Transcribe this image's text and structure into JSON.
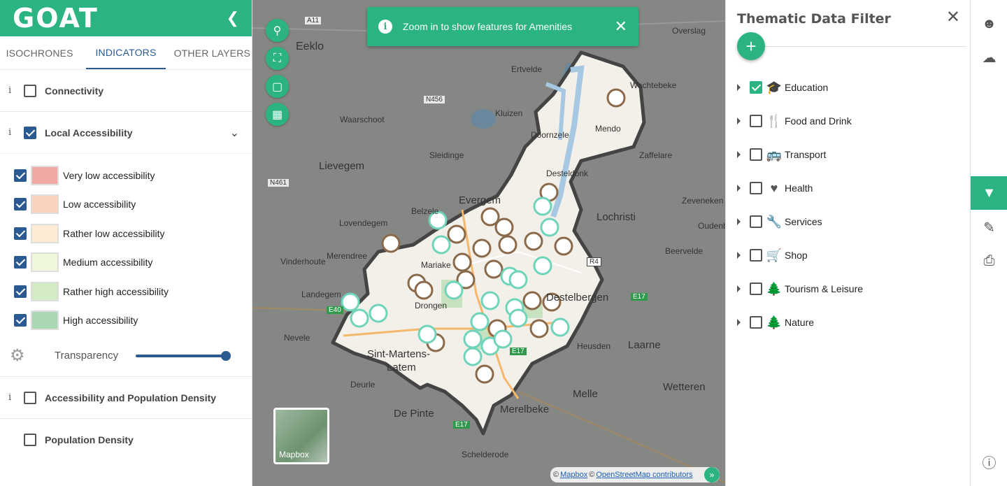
{
  "app": {
    "logo": "GOAT",
    "collapse_icon": "chevron-left-icon"
  },
  "tabs": [
    {
      "label": "ISOCHRONES",
      "active": false
    },
    {
      "label": "INDICATORS",
      "active": true
    },
    {
      "label": "OTHER LAYERS",
      "active": false
    }
  ],
  "layers": {
    "connectivity": {
      "label": "Connectivity",
      "checked": false
    },
    "local_accessibility": {
      "label": "Local Accessibility",
      "checked": true
    },
    "access_pop": {
      "label": "Accessibility and Population Density",
      "checked": false
    },
    "pop_density": {
      "label": "Population Density",
      "checked": false
    }
  },
  "legend": [
    {
      "label": "Very low accessibility",
      "color": "#f2a8a2",
      "checked": true
    },
    {
      "label": "Low accessibility",
      "color": "#fbd3bd",
      "checked": true
    },
    {
      "label": "Rather low accessibility",
      "color": "#fdebd5",
      "checked": true
    },
    {
      "label": "Medium accessibility",
      "color": "#eef6dc",
      "checked": true
    },
    {
      "label": "Rather high accessibility",
      "color": "#d3ecc6",
      "checked": true
    },
    {
      "label": "High accessibility",
      "color": "#a9d6b3",
      "checked": true
    }
  ],
  "transparency": {
    "label": "Transparency",
    "value": 1.0
  },
  "toast": {
    "text": "Zoom in to show features for Amenities"
  },
  "map_labels": {
    "eeklo": "Eeklo",
    "ertvelde": "Ertvelde",
    "wachtebeke": "Wachtebeke",
    "overslag": "Overslag",
    "waarschoot": "Waarschoot",
    "kluizen": "Kluizen",
    "sleidinge": "Sleidinge",
    "zaffelare": "Zaffelare",
    "lievegem": "Lievegem",
    "desteldonk": "Desteldonk",
    "evergem": "Evergem",
    "lochristi": "Lochristi",
    "zeveneken": "Zeveneken",
    "lovendegem": "Lovendegem",
    "belzele": "Belzele",
    "oudenb": "Oudenb",
    "merendree": "Merendree",
    "mariakerke": "Mariake",
    "beervelde": "Beervelde",
    "vinderhoute": "Vinderhoute",
    "landegem": "Landegem",
    "drongen": "Drongen",
    "destelbergen": "Destelbergen",
    "nevele": "Nevele",
    "laarne": "Laarne",
    "heusden": "Heusden",
    "sint_martens": "Sint-Martens-",
    "latem": "Latem",
    "deurle": "Deurle",
    "wetteren": "Wetteren",
    "melle": "Melle",
    "merelbeke": "Merelbeke",
    "de_pinte": "De Pinte",
    "schelderode": "Schelderode",
    "mendonk": "Mendo",
    "doornzele": "Doornzele",
    "a11": "A11",
    "n456": "N456",
    "n461": "N461",
    "e40": "E40",
    "e17a": "E17",
    "e17b": "E17",
    "e17c": "E17",
    "r4": "R4"
  },
  "map_controls": [
    "search-icon",
    "fullscreen-icon",
    "measure-icon",
    "map-style-icon"
  ],
  "basemap": {
    "label": "Mapbox"
  },
  "attribution": {
    "prefix1": "©",
    "mapbox": "Mapbox",
    "prefix2": "©",
    "osm": "OpenStreetMap contributors",
    "expand": "»"
  },
  "filter": {
    "title": "Thematic Data Filter",
    "items": [
      {
        "label": "Education",
        "checked": true,
        "icon": "graduation-cap-icon",
        "glyph": "🎓"
      },
      {
        "label": "Food and Drink",
        "checked": false,
        "icon": "cutlery-icon",
        "glyph": "🍴"
      },
      {
        "label": "Transport",
        "checked": false,
        "icon": "bus-icon",
        "glyph": "🚌"
      },
      {
        "label": "Health",
        "checked": false,
        "icon": "heart-icon",
        "glyph": "♥"
      },
      {
        "label": "Services",
        "checked": false,
        "icon": "wrench-icon",
        "glyph": "🔧"
      },
      {
        "label": "Shop",
        "checked": false,
        "icon": "cart-icon",
        "glyph": "🛒"
      },
      {
        "label": "Tourism & Leisure",
        "checked": false,
        "icon": "tree-icon",
        "glyph": "🌲"
      },
      {
        "label": "Nature",
        "checked": false,
        "icon": "tree-icon",
        "glyph": "🌲"
      }
    ]
  },
  "rail": [
    "user-icon",
    "cloud-icon",
    "filter-icon",
    "edit-icon",
    "print-icon",
    "info-icon"
  ]
}
